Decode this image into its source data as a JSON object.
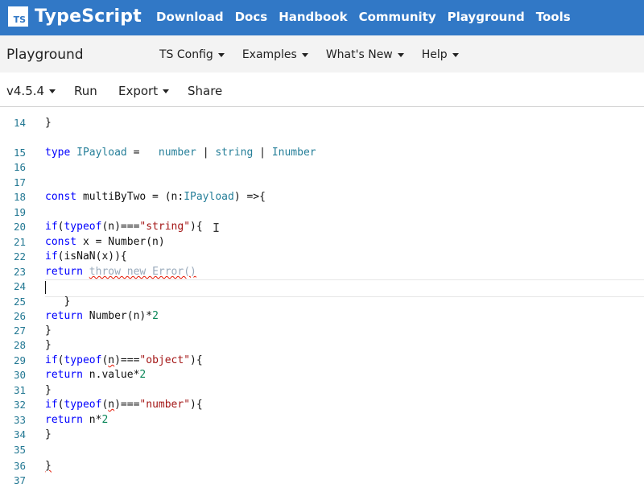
{
  "header": {
    "logo_text": "TS",
    "brand": "TypeScript",
    "nav": [
      "Download",
      "Docs",
      "Handbook",
      "Community",
      "Playground",
      "Tools"
    ]
  },
  "subnav": {
    "title": "Playground",
    "menus": [
      "TS Config",
      "Examples",
      "What's New",
      "Help"
    ]
  },
  "toolbar": {
    "version": "v4.5.4",
    "run": "Run",
    "export": "Export",
    "share": "Share"
  },
  "editor": {
    "line_numbers": [
      "14",
      "15",
      "16",
      "17",
      "18",
      "19",
      "20",
      "21",
      "22",
      "23",
      "24",
      "25",
      "26",
      "27",
      "28",
      "29",
      "30",
      "31",
      "32",
      "33",
      "34",
      "35",
      "36",
      "37"
    ]
  },
  "colors": {
    "brand_blue": "#3178c6",
    "error_red": "#e51400"
  }
}
